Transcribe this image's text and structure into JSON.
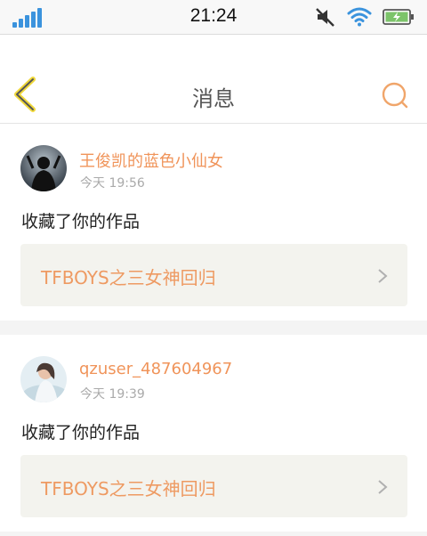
{
  "status_bar": {
    "time": "21:24",
    "icons": [
      "signal-icon",
      "mute-icon",
      "wifi-icon",
      "battery-charging-icon"
    ],
    "accent": "#3b93dd"
  },
  "header": {
    "title": "消息",
    "back_icon": "chevron-left-icon",
    "search_icon": "search-icon",
    "back_color": "#f0d83a",
    "search_color": "#f0a56a"
  },
  "notifications": [
    {
      "username": "王俊凯的蓝色小仙女",
      "time": "今天 19:56",
      "action": "收藏了你的作品",
      "work_title": "TFBOYS之三女神回归"
    },
    {
      "username": "qzuser_487604967",
      "time": "今天 19:39",
      "action": "收藏了你的作品",
      "work_title": "TFBOYS之三女神回归"
    }
  ],
  "colors": {
    "username": "#f0945a",
    "work_title": "#ee9a62",
    "work_bg": "#f3f3ee"
  }
}
